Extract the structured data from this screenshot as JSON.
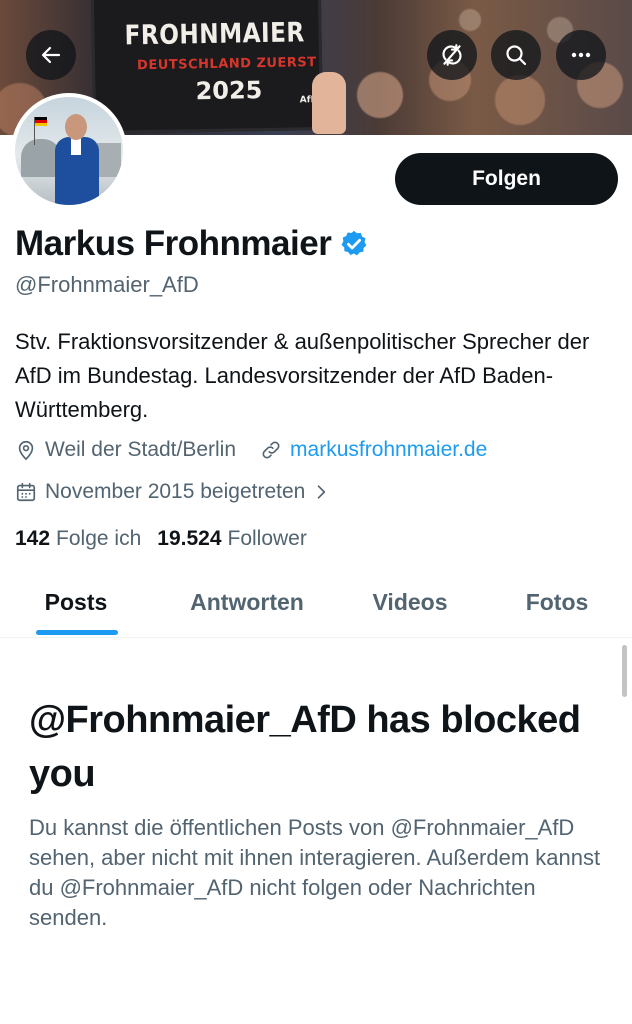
{
  "banner": {
    "sign_line1": "FROHNMAIER",
    "sign_line2": "DEUTSCHLAND ZUERST",
    "sign_line3": "2025",
    "sign_logo": "AfD"
  },
  "header": {
    "back_icon": "arrow-left-icon",
    "nosync_icon": "sync-off-icon",
    "search_icon": "search-icon",
    "more_icon": "more-horizontal-icon"
  },
  "profile": {
    "follow_label": "Folgen",
    "name": "Markus Frohnmaier",
    "handle": "@Frohnmaier_AfD",
    "bio": "Stv. Fraktionsvorsitzender & außenpolitischer Sprecher der AfD im Bundestag. Landesvorsitzender der AfD Baden-Württemberg.",
    "location": "Weil der Stadt/Berlin",
    "website": "markusfrohnmaier.de",
    "joined": "November 2015 beigetreten",
    "following_count": "142",
    "following_label": "Folge ich",
    "followers_count": "19.524",
    "followers_label": "Follower"
  },
  "tabs": [
    {
      "label": "Posts",
      "active": true
    },
    {
      "label": "Antworten",
      "active": false
    },
    {
      "label": "Videos",
      "active": false
    },
    {
      "label": "Fotos",
      "active": false
    }
  ],
  "blocked": {
    "title": "@Frohnmaier_AfD has blocked you",
    "text": "Du kannst die öffentlichen Posts von @Frohnmaier_AfD sehen, aber nicht mit ihnen interagieren. Außerdem kannst du @Frohnmaier_AfD nicht folgen oder Nachrichten senden."
  },
  "colors": {
    "accent": "#1d9bf0",
    "text": "#0f1419",
    "secondary": "#536471"
  }
}
